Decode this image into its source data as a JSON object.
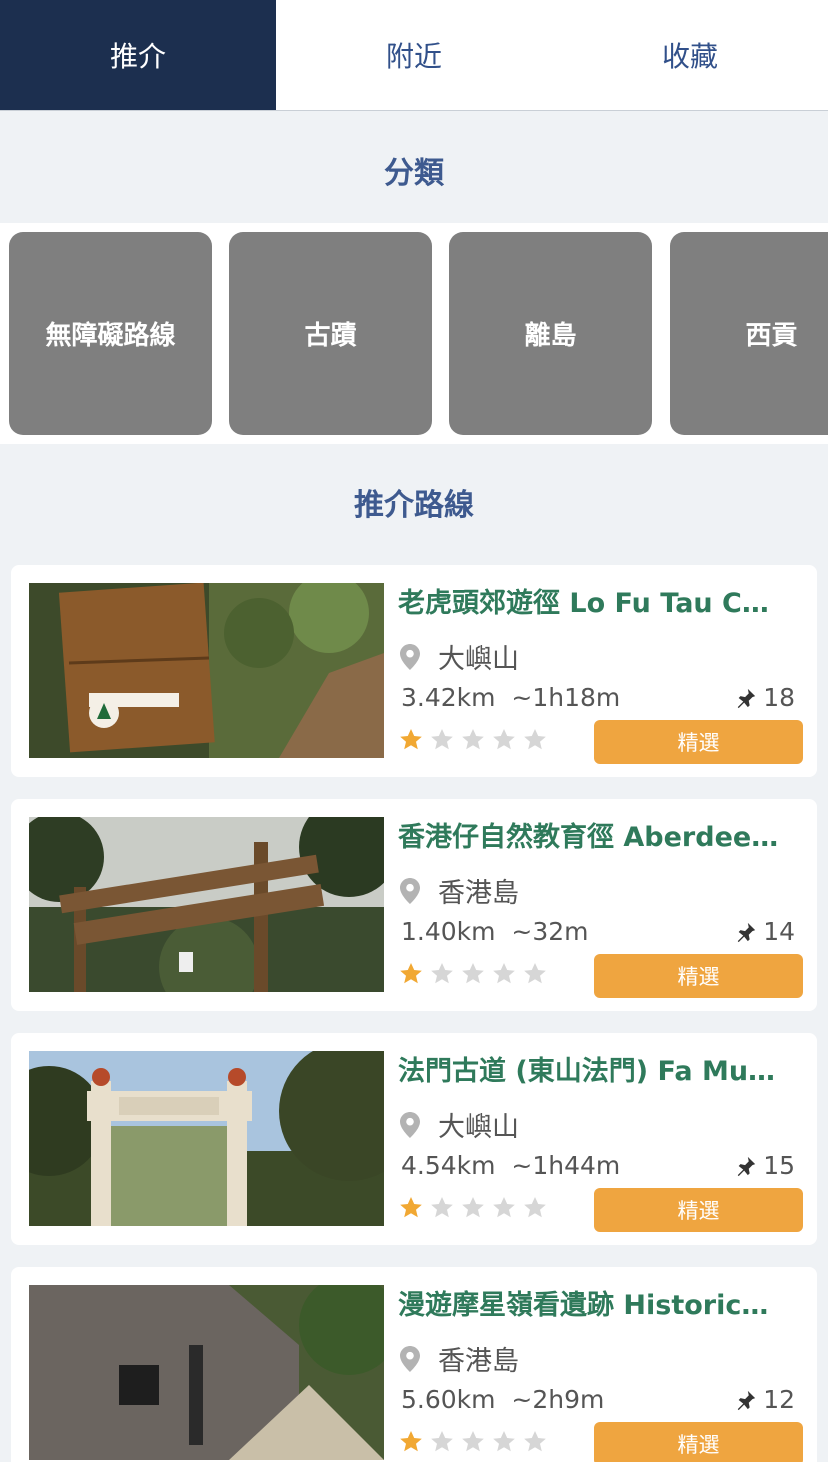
{
  "tabs": [
    {
      "label": "推介",
      "active": true
    },
    {
      "label": "附近",
      "active": false
    },
    {
      "label": "收藏",
      "active": false
    }
  ],
  "categories_title": "分類",
  "categories": [
    "無障礙路線",
    "古蹟",
    "離島",
    "西貢"
  ],
  "recommended_title": "推介路線",
  "routes": [
    {
      "title": "老虎頭郊遊徑 Lo Fu Tau C…",
      "location": "大嶼山",
      "distance": "3.42km",
      "duration": "~1h18m",
      "pins": "18",
      "rating": 1,
      "badge": "精選",
      "image": "wooden trail sign: 老虎頭郊遊徑 LO FU TAU COUNTRY TRAIL"
    },
    {
      "title": "香港仔自然教育徑 Aberdee…",
      "location": "香港島",
      "distance": "1.40km",
      "duration": "~32m",
      "pins": "14",
      "rating": 1,
      "badge": "精選",
      "image": "wooden arch sign: 香港仔自然教育徑 ABERDEEN NATURE TRAIL"
    },
    {
      "title": "法門古道 (東山法門) Fa Mu…",
      "location": "大嶼山",
      "distance": "4.54km",
      "duration": "~1h44m",
      "pins": "15",
      "rating": 1,
      "badge": "精選",
      "image": "stone gateway: 東山法門"
    },
    {
      "title": "漫遊摩星嶺看遺跡 Historic…",
      "location": "香港島",
      "distance": "5.60km",
      "duration": "~2h9m",
      "pins": "12",
      "rating": 1,
      "badge": "精選",
      "image": "ruined building along path"
    }
  ],
  "colors": {
    "active_tab": "#1c2f4f",
    "title_blue": "#3e5a8f",
    "route_green": "#2f7a5b",
    "badge_orange": "#efa540",
    "star_gold": "#f1a833",
    "category_grey": "#7f7f7f"
  }
}
